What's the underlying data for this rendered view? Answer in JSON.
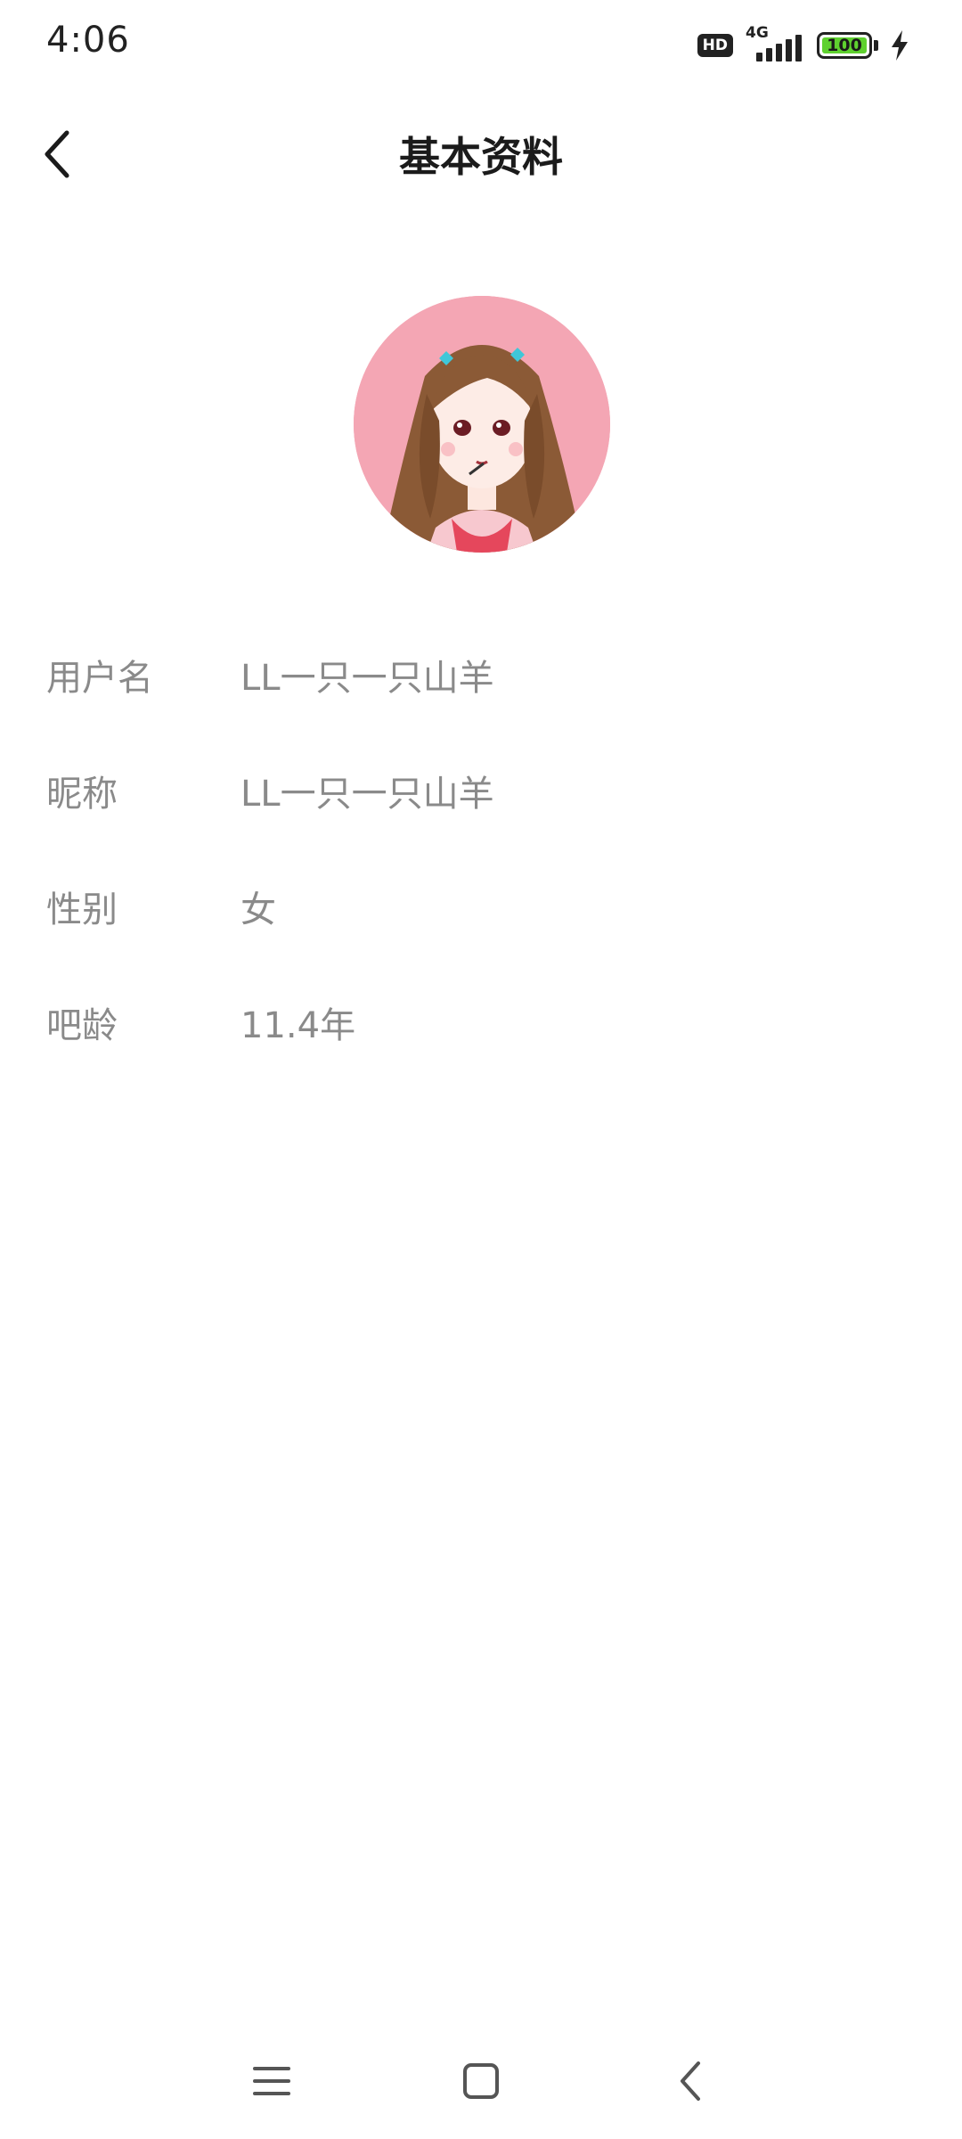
{
  "status_bar": {
    "time": "4:06",
    "hd_label": "HD",
    "network_label": "4G",
    "battery_level": "100",
    "charging_icon": "lightning-bolt-icon"
  },
  "header": {
    "back_icon": "chevron-left-icon",
    "title": "基本资料"
  },
  "avatar": {
    "icon": "cartoon-girl-avatar",
    "background_color": "#f4a6b4"
  },
  "profile": {
    "rows": [
      {
        "label": "用户名",
        "value": "LL一只一只山羊"
      },
      {
        "label": "昵称",
        "value": "LL一只一只山羊"
      },
      {
        "label": "性别",
        "value": "女"
      },
      {
        "label": "吧龄",
        "value": "11.4年"
      }
    ]
  },
  "nav_bar": {
    "menu_icon": "menu-icon",
    "home_icon": "home-square-icon",
    "back_icon": "back-triangle-icon"
  },
  "colors": {
    "battery_fill": "#5fd12f",
    "text_secondary": "#8a8a8a",
    "title": "#1b1b1b"
  }
}
